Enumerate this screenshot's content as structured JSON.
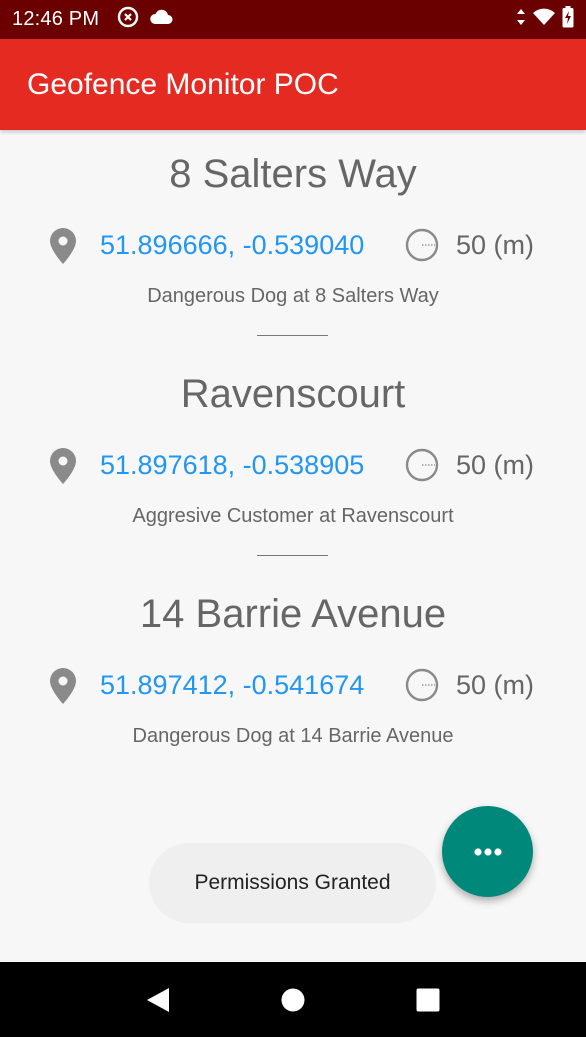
{
  "status_bar": {
    "time": "12:46 PM",
    "icons_left": [
      "sync-disabled-icon",
      "cloud-icon"
    ],
    "icons_right": [
      "data-arrows-icon",
      "wifi-icon",
      "battery-icon"
    ]
  },
  "app_bar": {
    "title": "Geofence Monitor POC"
  },
  "fences": [
    {
      "title": "8 Salters Way",
      "coords": "51.896666, -0.539040",
      "radius": "50 (m)",
      "description": "Dangerous Dog at 8 Salters Way"
    },
    {
      "title": "Ravenscourt",
      "coords": "51.897618, -0.538905",
      "radius": "50 (m)",
      "description": "Aggresive Customer at Ravenscourt"
    },
    {
      "title": "14 Barrie Avenue",
      "coords": "51.897412, -0.541674",
      "radius": "50 (m)",
      "description": "Dangerous Dog at 14 Barrie Avenue"
    }
  ],
  "toast": {
    "text": "Permissions Granted"
  },
  "fab": {
    "icon": "more-horiz-icon"
  },
  "nav_bar": {
    "icons": [
      "back-icon",
      "home-icon",
      "recents-icon"
    ]
  },
  "colors": {
    "status_bar": "#6b0000",
    "app_bar": "#e52a22",
    "coords_link": "#2196f3",
    "fab": "#00897b",
    "text_gray": "#666666"
  }
}
